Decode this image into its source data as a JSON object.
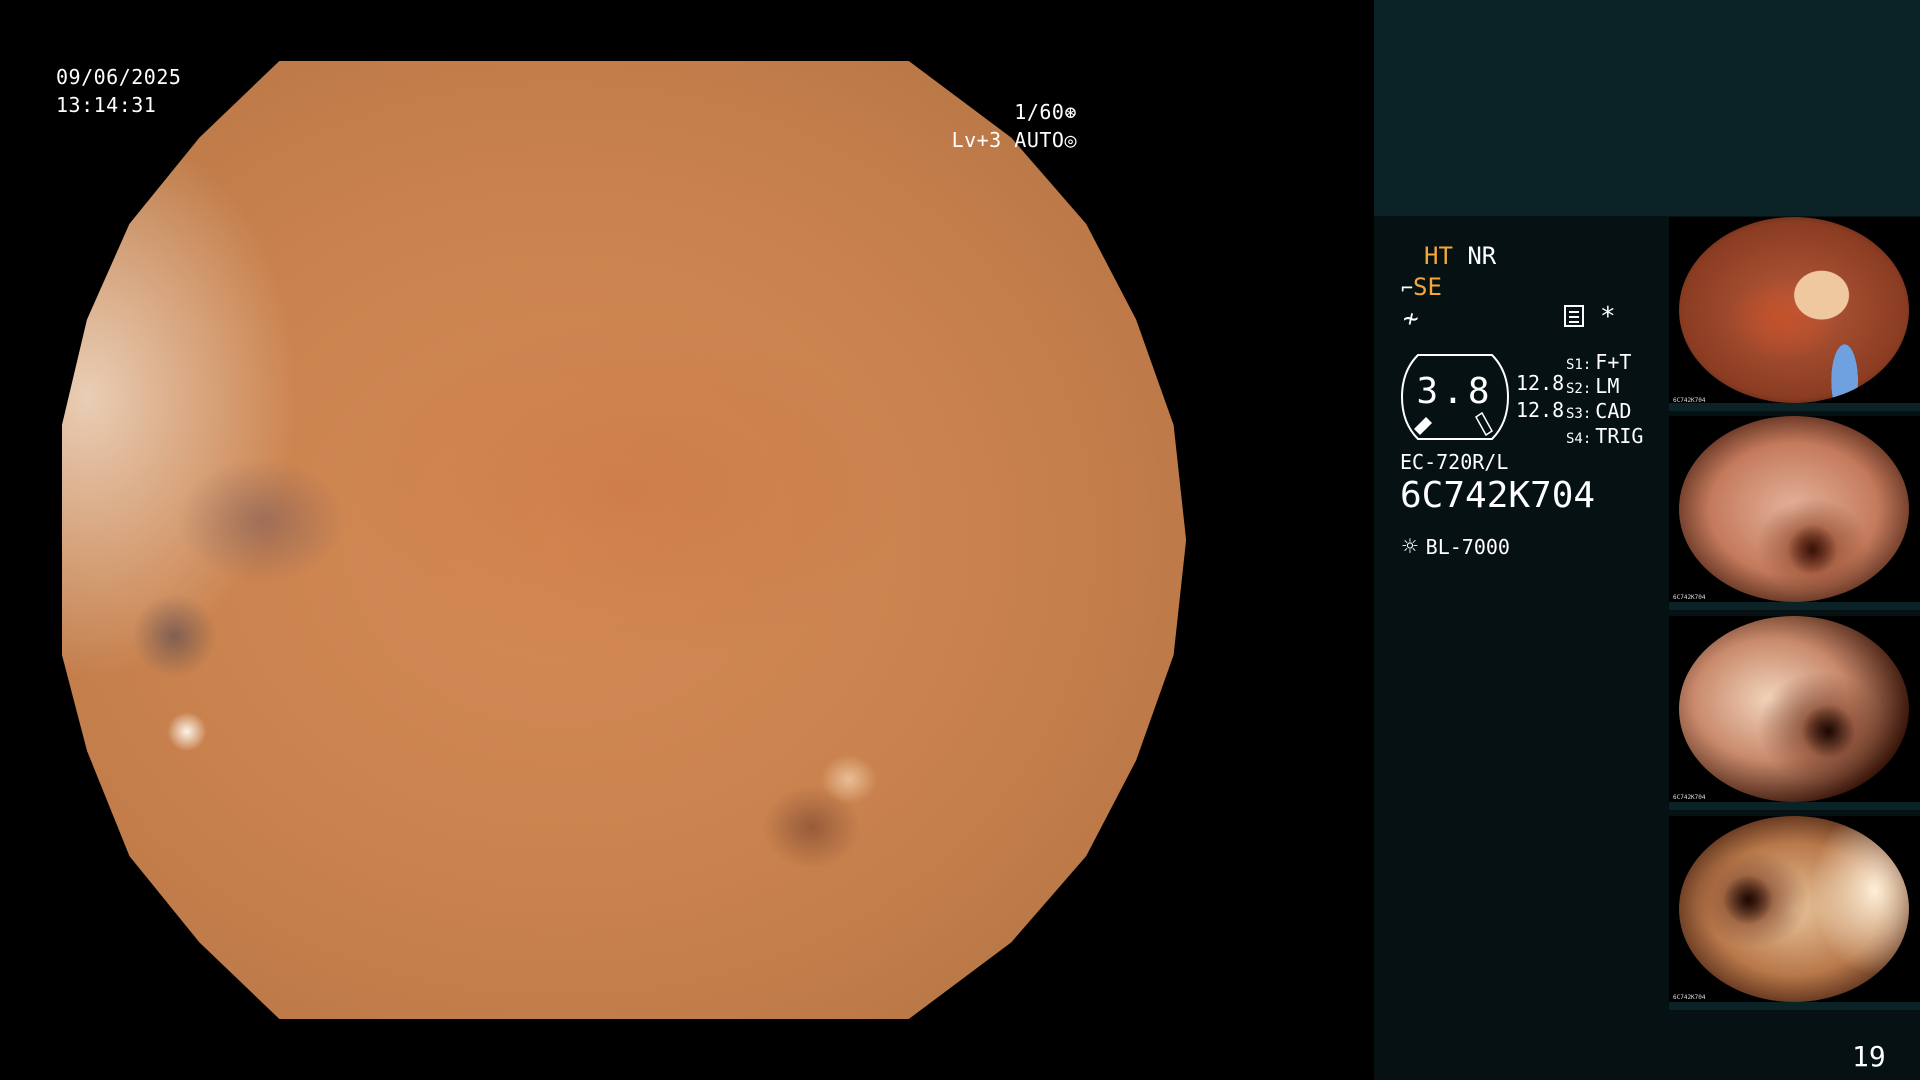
{
  "overlay": {
    "date": "09/06/2025",
    "time": "13:14:31",
    "shutter": "1/60",
    "level": "Lv+3",
    "mode": "AUTO"
  },
  "panel": {
    "ht": "HT",
    "nr": "NR",
    "se": "SE",
    "gauge_value": "3.8",
    "value_1": "12.8",
    "value_2": "12.8",
    "slots": [
      {
        "key": "S1:",
        "label": "F+T"
      },
      {
        "key": "S2:",
        "label": "LM"
      },
      {
        "key": "S3:",
        "label": "CAD"
      },
      {
        "key": "S4:",
        "label": "TRIG"
      }
    ],
    "scope_model": "EC-720R/L",
    "serial": "6C742K704",
    "light_source": "BL-7000",
    "page_number": "19"
  },
  "thumbnails": [
    {
      "id": "6C742K704"
    },
    {
      "id": "6C742K704"
    },
    {
      "id": "6C742K704"
    },
    {
      "id": "6C742K704"
    }
  ],
  "colors": {
    "highlight": "#f3a83b",
    "panel_top": "#0b2326",
    "panel": "#061113"
  }
}
